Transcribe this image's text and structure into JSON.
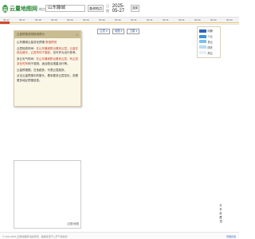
{
  "header": {
    "logo_glyph": "云",
    "logo_text": "云量地图网",
    "location_prefix": "地点:",
    "location_value": "山东滕城",
    "query_label": "查询地点",
    "date_prefix": "日期",
    "date_value": "2025-05-27",
    "date_button": "选择"
  },
  "timeline": {
    "labels": [
      "05-27",
      "05-27",
      "05-28",
      "05-28",
      "05-29",
      "05-29",
      "05-30",
      "05-30",
      "05-31",
      "05-31",
      "06-01",
      "06-01",
      "06-02",
      "06-02",
      "06-03"
    ],
    "accent_color": "#f0c36b",
    "head_color": "#d04a2c"
  },
  "card": {
    "title": "云量预报说明使用提示",
    "close": "×",
    "lines": [
      {
        "pre": "山东滕城云量变化预报 ",
        "hl": "数值预测",
        "post": ""
      },
      {
        "pre": "云层较低时间：",
        "hl": "在山东滕城附近看到云层，云量在前后增长，云层有利于摄影",
        "post": "，也可作为出行参考。"
      },
      {
        "pre": "多云天气时间：",
        "hl": "在山东滕城附近看到云层，有云层变化时有",
        "post": "利于观测，适合配合观星出行等。"
      },
      {
        "pre": "云量预报图，",
        "hl": "",
        "post": "白色越多、代表云层越多。"
      },
      {
        "pre": "点击云量预报中的箭头，看到更多云层变化，",
        "hl": "",
        "post": "查看更多地区预报信息。"
      }
    ]
  },
  "map_box": {
    "label": "云图/地图"
  },
  "map_controls": {
    "items": [
      "云层 ▾",
      "地图 ▾",
      "卫星 ▾"
    ]
  },
  "legend": {
    "items": [
      {
        "label": "晴朗",
        "color": "#2a66b8"
      },
      {
        "label": "少云",
        "color": "#3f93d6"
      },
      {
        "label": "多云",
        "color": "#7cc0ec"
      },
      {
        "label": "阴天",
        "color": "#b7dcf2"
      },
      {
        "label": "厚云",
        "color": "#e8eef3"
      }
    ]
  },
  "side_tools": {
    "items": [
      "分",
      "享",
      "收",
      "藏",
      "顶"
    ]
  },
  "footer": {
    "left": "© 2024-2025 云量地图网 版权所有 · 数据来源于公开气象模式",
    "right": "问题反馈"
  }
}
